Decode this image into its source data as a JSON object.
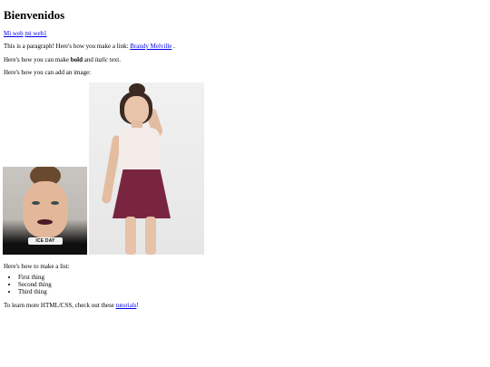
{
  "heading": "Bienvenidos",
  "links": {
    "link1": "Mi web",
    "link2": "mi web1"
  },
  "paragraph1": {
    "prefix": "This is a paragraph! Here's how you make a link: ",
    "link": "Brandy Melville",
    "suffix": " ."
  },
  "paragraph2": {
    "prefix": "Here's how you can make ",
    "bold": "bold",
    "middle": " and ",
    "italic": "italic",
    "suffix": " text."
  },
  "paragraph3": "Here's how you can add an image:",
  "shirt_text": "ICE DAY",
  "paragraph4": "Here's how to make a list:",
  "list": [
    "First thing",
    "Second thing",
    "Third thing"
  ],
  "paragraph5": {
    "prefix": "To learn more HTML/CSS, check out these ",
    "link": "tutorials",
    "suffix": "!"
  }
}
